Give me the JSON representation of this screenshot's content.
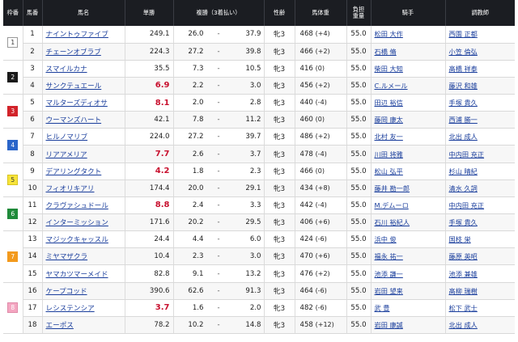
{
  "header": {
    "frame": "枠番",
    "num": "馬番",
    "name": "馬名",
    "win": "単勝",
    "place": "複勝（3着払い）",
    "sex_age": "性齢",
    "weight": "馬体重",
    "load_1": "負担",
    "load_2": "重量",
    "jockey": "騎手",
    "trainer": "調教師"
  },
  "colors": {
    "frame_1": "#ffffff",
    "frame_2": "#1a1a1a",
    "frame_3": "#d2232a",
    "frame_4": "#2a65c9",
    "frame_5": "#f7e43a",
    "frame_6": "#1f8a3a",
    "frame_7": "#f39a1d",
    "frame_8": "#f4a6c1",
    "odds_highlight": "#c8102e",
    "link": "#1a3e9c"
  },
  "frames": [
    {
      "label": "1",
      "rows": 2,
      "bg": "#ffffff",
      "fg": "#333333",
      "border": "#999999"
    },
    {
      "label": "2",
      "rows": 2,
      "bg": "#1a1a1a",
      "fg": "#ffffff",
      "border": "#1a1a1a"
    },
    {
      "label": "3",
      "rows": 2,
      "bg": "#d2232a",
      "fg": "#ffffff",
      "border": "#d2232a"
    },
    {
      "label": "4",
      "rows": 2,
      "bg": "#2a65c9",
      "fg": "#ffffff",
      "border": "#2a65c9"
    },
    {
      "label": "5",
      "rows": 2,
      "bg": "#f7e43a",
      "fg": "#333333",
      "border": "#d8c420"
    },
    {
      "label": "6",
      "rows": 2,
      "bg": "#1f8a3a",
      "fg": "#ffffff",
      "border": "#1f8a3a"
    },
    {
      "label": "7",
      "rows": 3,
      "bg": "#f39a1d",
      "fg": "#ffffff",
      "border": "#f39a1d"
    },
    {
      "label": "8",
      "rows": 3,
      "bg": "#f4a6c1",
      "fg": "#ffffff",
      "border": "#e08aa8"
    }
  ],
  "horses": [
    {
      "num": "1",
      "name": "ナイントゥファイブ",
      "odds": "249.1",
      "hot": false,
      "place_min": "26.0",
      "place_max": "37.9",
      "sex_age": "牝3",
      "weight": "468",
      "diff": "(+4)",
      "load": "55.0",
      "jockey": "松田 大作",
      "trainer": "西園 正都"
    },
    {
      "num": "2",
      "name": "チェーンオブラブ",
      "odds": "224.3",
      "hot": false,
      "place_min": "27.2",
      "place_max": "39.8",
      "sex_age": "牝3",
      "weight": "466",
      "diff": "(+2)",
      "load": "55.0",
      "jockey": "石橋 脩",
      "trainer": "小笠 倫弘"
    },
    {
      "num": "3",
      "name": "スマイルカナ",
      "odds": "35.5",
      "hot": false,
      "place_min": "7.3",
      "place_max": "10.5",
      "sex_age": "牝3",
      "weight": "416",
      "diff": "(0)",
      "load": "55.0",
      "jockey": "柴田 大知",
      "trainer": "高橋 祥泰"
    },
    {
      "num": "4",
      "name": "サンクテュエール",
      "odds": "6.9",
      "hot": true,
      "place_min": "2.2",
      "place_max": "3.0",
      "sex_age": "牝3",
      "weight": "456",
      "diff": "(+2)",
      "load": "55.0",
      "jockey": "C.ルメール",
      "trainer": "藤沢 和雄"
    },
    {
      "num": "5",
      "name": "マルターズディオサ",
      "odds": "8.1",
      "hot": true,
      "place_min": "2.0",
      "place_max": "2.8",
      "sex_age": "牝3",
      "weight": "440",
      "diff": "(-4)",
      "load": "55.0",
      "jockey": "田辺 裕信",
      "trainer": "手塚 貴久"
    },
    {
      "num": "6",
      "name": "ウーマンズハート",
      "odds": "42.1",
      "hot": false,
      "place_min": "7.8",
      "place_max": "11.2",
      "sex_age": "牝3",
      "weight": "460",
      "diff": "(0)",
      "load": "55.0",
      "jockey": "藤岡 康太",
      "trainer": "西浦 勝一"
    },
    {
      "num": "7",
      "name": "ヒルノマリブ",
      "odds": "224.0",
      "hot": false,
      "place_min": "27.2",
      "place_max": "39.7",
      "sex_age": "牝3",
      "weight": "486",
      "diff": "(+2)",
      "load": "55.0",
      "jockey": "北村 友一",
      "trainer": "北出 成人"
    },
    {
      "num": "8",
      "name": "リアアメリア",
      "odds": "7.7",
      "hot": true,
      "place_min": "2.6",
      "place_max": "3.7",
      "sex_age": "牝3",
      "weight": "478",
      "diff": "(-4)",
      "load": "55.0",
      "jockey": "川田 将雅",
      "trainer": "中内田 充正"
    },
    {
      "num": "9",
      "name": "デアリングタクト",
      "odds": "4.2",
      "hot": true,
      "place_min": "1.8",
      "place_max": "2.3",
      "sex_age": "牝3",
      "weight": "466",
      "diff": "(0)",
      "load": "55.0",
      "jockey": "松山 弘平",
      "trainer": "杉山 晴紀"
    },
    {
      "num": "10",
      "name": "フィオリキアリ",
      "odds": "174.4",
      "hot": false,
      "place_min": "20.0",
      "place_max": "29.1",
      "sex_age": "牝3",
      "weight": "434",
      "diff": "(+8)",
      "load": "55.0",
      "jockey": "藤井 勘一郎",
      "trainer": "清水 久詞"
    },
    {
      "num": "11",
      "name": "クラヴァシュドール",
      "odds": "8.8",
      "hot": true,
      "place_min": "2.4",
      "place_max": "3.3",
      "sex_age": "牝3",
      "weight": "442",
      "diff": "(-4)",
      "load": "55.0",
      "jockey": "M.デムーロ",
      "trainer": "中内田 充正"
    },
    {
      "num": "12",
      "name": "インターミッション",
      "odds": "171.6",
      "hot": false,
      "place_min": "20.2",
      "place_max": "29.5",
      "sex_age": "牝3",
      "weight": "406",
      "diff": "(+6)",
      "load": "55.0",
      "jockey": "石川 裕紀人",
      "trainer": "手塚 貴久"
    },
    {
      "num": "13",
      "name": "マジックキャッスル",
      "odds": "24.4",
      "hot": false,
      "place_min": "4.4",
      "place_max": "6.0",
      "sex_age": "牝3",
      "weight": "424",
      "diff": "(-6)",
      "load": "55.0",
      "jockey": "浜中 俊",
      "trainer": "国枝 栄"
    },
    {
      "num": "14",
      "name": "ミヤマザクラ",
      "odds": "10.4",
      "hot": false,
      "place_min": "2.3",
      "place_max": "3.0",
      "sex_age": "牝3",
      "weight": "470",
      "diff": "(+6)",
      "load": "55.0",
      "jockey": "福永 祐一",
      "trainer": "藤原 英昭"
    },
    {
      "num": "15",
      "name": "ヤマカツマーメイド",
      "odds": "82.8",
      "hot": false,
      "place_min": "9.1",
      "place_max": "13.2",
      "sex_age": "牝3",
      "weight": "476",
      "diff": "(+2)",
      "load": "55.0",
      "jockey": "池添 謙一",
      "trainer": "池添 兼雄"
    },
    {
      "num": "16",
      "name": "ケープコッド",
      "odds": "390.6",
      "hot": false,
      "place_min": "62.6",
      "place_max": "91.3",
      "sex_age": "牝3",
      "weight": "464",
      "diff": "(-6)",
      "load": "55.0",
      "jockey": "岩田 望来",
      "trainer": "高柳 瑞樹"
    },
    {
      "num": "17",
      "name": "レシステンシア",
      "odds": "3.7",
      "hot": true,
      "place_min": "1.6",
      "place_max": "2.0",
      "sex_age": "牝3",
      "weight": "482",
      "diff": "(-6)",
      "load": "55.0",
      "jockey": "武 豊",
      "trainer": "松下 武士"
    },
    {
      "num": "18",
      "name": "エーポス",
      "odds": "78.2",
      "hot": false,
      "place_min": "10.2",
      "place_max": "14.8",
      "sex_age": "牝3",
      "weight": "458",
      "diff": "(+12)",
      "load": "55.0",
      "jockey": "岩田 康誠",
      "trainer": "北出 成人"
    }
  ]
}
